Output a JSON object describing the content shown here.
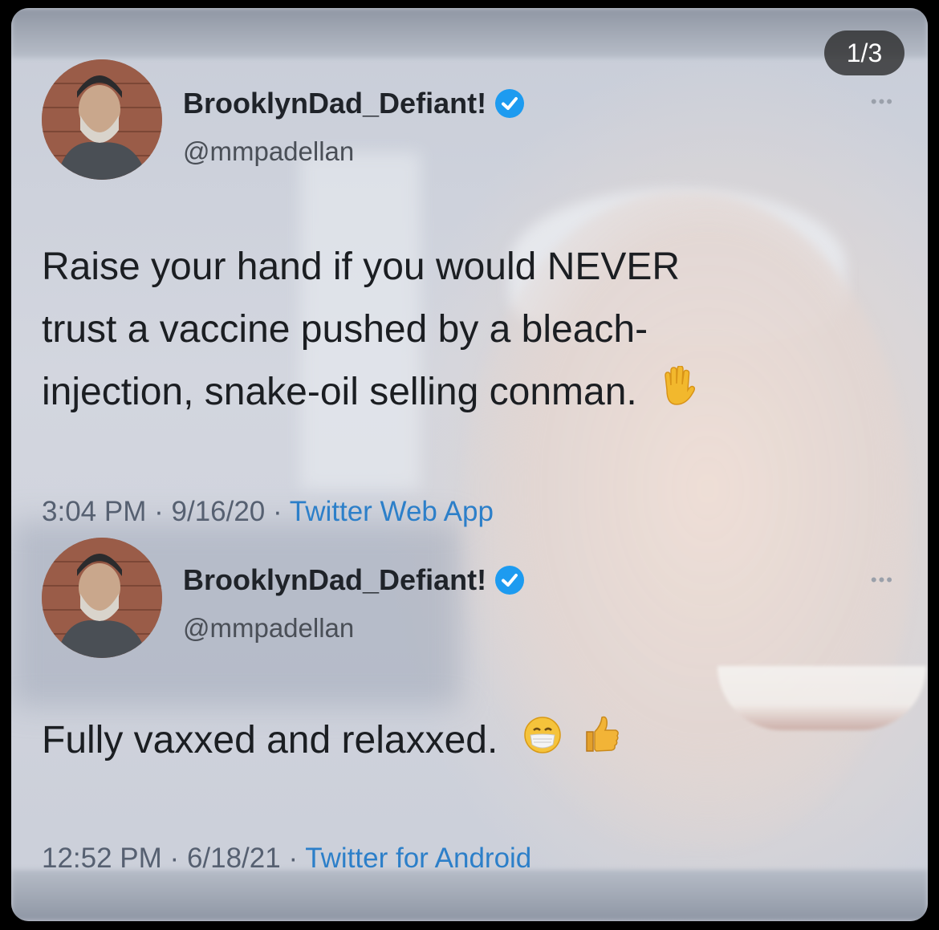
{
  "counter": "1/3",
  "tweets": [
    {
      "display_name": "BrooklynDad_Defiant!",
      "handle": "@mmpadellan",
      "text_lines": [
        "Raise your hand if you would NEVER",
        "trust a vaccine pushed by a bleach-",
        "injection, snake-oil selling conman."
      ],
      "emoji": [
        "raised-hand-icon"
      ],
      "time": "3:04 PM",
      "date": "9/16/20",
      "app": "Twitter Web App",
      "separator": "·"
    },
    {
      "display_name": "BrooklynDad_Defiant!",
      "handle": "@mmpadellan",
      "text_lines": [
        "Fully vaxxed and relaxxed."
      ],
      "emoji": [
        "face-with-medical-mask-icon",
        "thumbs-up-icon"
      ],
      "time": "12:52 PM",
      "date": "6/18/21",
      "app": "Twitter for Android",
      "separator": "·"
    }
  ],
  "colors": {
    "verified": "#1d9bf0",
    "link": "#2c7fc9",
    "text": "#1b1e22",
    "muted": "#566071"
  }
}
